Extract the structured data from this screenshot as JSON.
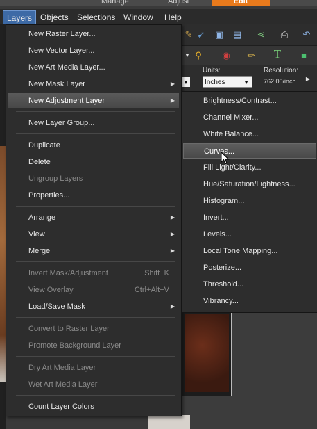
{
  "top_tabs": {
    "manage": "Manage",
    "adjust": "Adjust",
    "edit": "Edit"
  },
  "menubar": [
    "Layers",
    "Objects",
    "Selections",
    "Window",
    "Help"
  ],
  "layers_menu": {
    "group1": [
      {
        "label": "New Raster Layer...",
        "enabled": true
      },
      {
        "label": "New Vector Layer...",
        "enabled": true
      },
      {
        "label": "New Art Media Layer...",
        "enabled": true
      },
      {
        "label": "New Mask Layer",
        "enabled": true,
        "submenu": true
      },
      {
        "label": "New Adjustment Layer",
        "enabled": true,
        "submenu": true,
        "active": true
      }
    ],
    "group2": [
      {
        "label": "New Layer Group...",
        "enabled": true
      }
    ],
    "group3": [
      {
        "label": "Duplicate",
        "enabled": true
      },
      {
        "label": "Delete",
        "enabled": true
      },
      {
        "label": "Ungroup Layers",
        "enabled": false
      },
      {
        "label": "Properties...",
        "enabled": true
      }
    ],
    "group4": [
      {
        "label": "Arrange",
        "enabled": true,
        "submenu": true
      },
      {
        "label": "View",
        "enabled": true,
        "submenu": true
      },
      {
        "label": "Merge",
        "enabled": true,
        "submenu": true
      }
    ],
    "group5": [
      {
        "label": "Invert Mask/Adjustment",
        "enabled": false,
        "shortcut": "Shift+K"
      },
      {
        "label": "View Overlay",
        "enabled": false,
        "shortcut": "Ctrl+Alt+V"
      },
      {
        "label": "Load/Save Mask",
        "enabled": true,
        "submenu": true
      }
    ],
    "group6": [
      {
        "label": "Convert to Raster Layer",
        "enabled": false
      },
      {
        "label": "Promote Background Layer",
        "enabled": false
      }
    ],
    "group7": [
      {
        "label": "Dry Art Media Layer",
        "enabled": false
      },
      {
        "label": "Wet Art Media Layer",
        "enabled": false
      }
    ],
    "group8": [
      {
        "label": "Count Layer Colors",
        "enabled": true
      }
    ]
  },
  "adjustment_submenu": [
    "Brightness/Contrast...",
    "Channel Mixer...",
    "White Balance...",
    "Curves...",
    "Fill Light/Clarity...",
    "Hue/Saturation/Lightness...",
    "Histogram...",
    "Invert...",
    "Levels...",
    "Local Tone Mapping...",
    "Posterize...",
    "Threshold...",
    "Vibrancy..."
  ],
  "hovered_submenu_item": "Curves...",
  "toolbar": {
    "units_label": "Units:",
    "units_value": "Inches",
    "resolution_label": "Resolution:",
    "resolution_value": "762.00/inch"
  },
  "colors": {
    "menu_bg": "#2d2d2d",
    "menubar_active": "#3d6aa6",
    "edit_tab": "#e87a1c",
    "disabled_text": "#8a8a8a"
  }
}
